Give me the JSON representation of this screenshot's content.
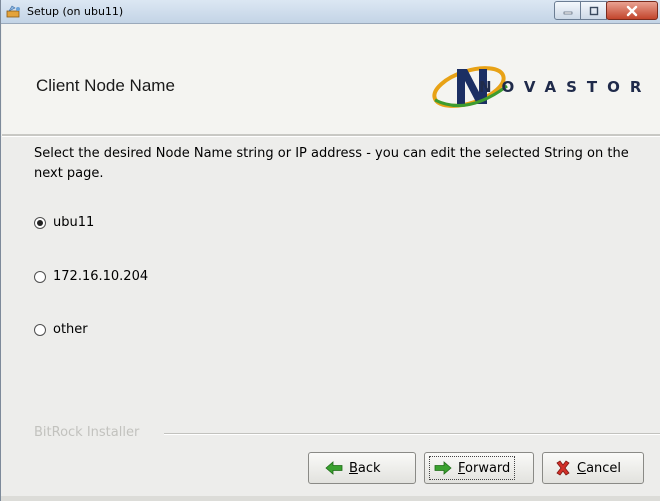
{
  "window": {
    "title": "Setup (on ubu11)"
  },
  "header": {
    "title": "Client Node Name",
    "logo_text": "NOVASTOR"
  },
  "main": {
    "instruction": "Select the desired Node Name string or IP address - you can edit the selected String on the next page.",
    "options": [
      {
        "label": "ubu11",
        "selected": true
      },
      {
        "label": "172.16.10.204",
        "selected": false
      },
      {
        "label": "other",
        "selected": false
      }
    ],
    "installer_label": "BitRock Installer"
  },
  "buttons": {
    "back": {
      "mnemonic": "B",
      "rest": "ack"
    },
    "forward": {
      "mnemonic": "F",
      "rest": "orward"
    },
    "cancel": {
      "mnemonic": "C",
      "rest": "ancel"
    }
  },
  "colors": {
    "arrow_green": "#3aa12f",
    "cancel_red": "#d2312a",
    "logo_accent": "#e8a216"
  }
}
